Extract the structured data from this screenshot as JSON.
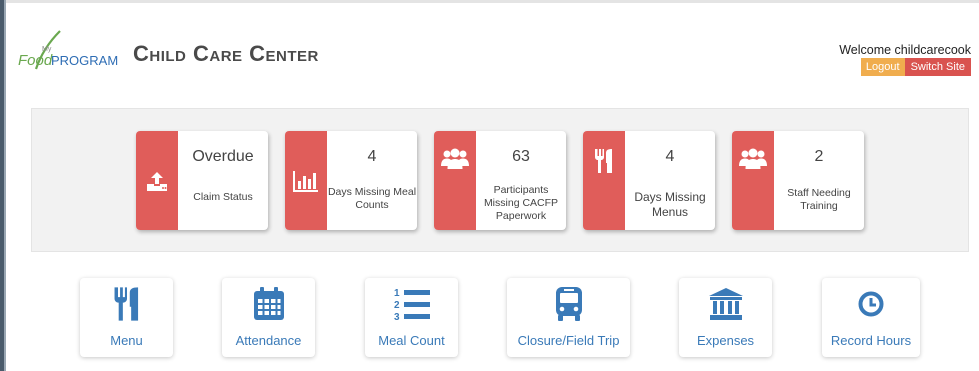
{
  "header": {
    "logo_text": "MyFoodPROGRAM",
    "title": "Child Care Center",
    "welcome": "Welcome childcarecook",
    "logout_label": "Logout",
    "switch_label": "Switch Site"
  },
  "colors": {
    "card_accent": "#e05d5a",
    "tile_accent": "#3a7ab8",
    "logout": "#f0ad4e",
    "switch": "#d9534f"
  },
  "cards": [
    {
      "value": "Overdue",
      "label": "Claim Status",
      "icon": "upload-icon"
    },
    {
      "value": "4",
      "label": "Days Missing Meal Counts",
      "icon": "bar-chart-icon"
    },
    {
      "value": "63",
      "label": "Participants Missing CACFP Paperwork",
      "icon": "group-icon"
    },
    {
      "value": "4",
      "label": "Days Missing Menus",
      "icon": "fork-knife-icon"
    },
    {
      "value": "2",
      "label": "Staff Needing Training",
      "icon": "group-icon"
    }
  ],
  "tiles": [
    {
      "label": "Menu",
      "icon": "fork-knife-icon"
    },
    {
      "label": "Attendance",
      "icon": "calendar-icon"
    },
    {
      "label": "Meal Count",
      "icon": "numbered-list-icon"
    },
    {
      "label": "Closure/Field Trip",
      "icon": "bus-icon"
    },
    {
      "label": "Expenses",
      "icon": "bank-icon"
    },
    {
      "label": "Record Hours",
      "icon": "clock-icon"
    }
  ]
}
